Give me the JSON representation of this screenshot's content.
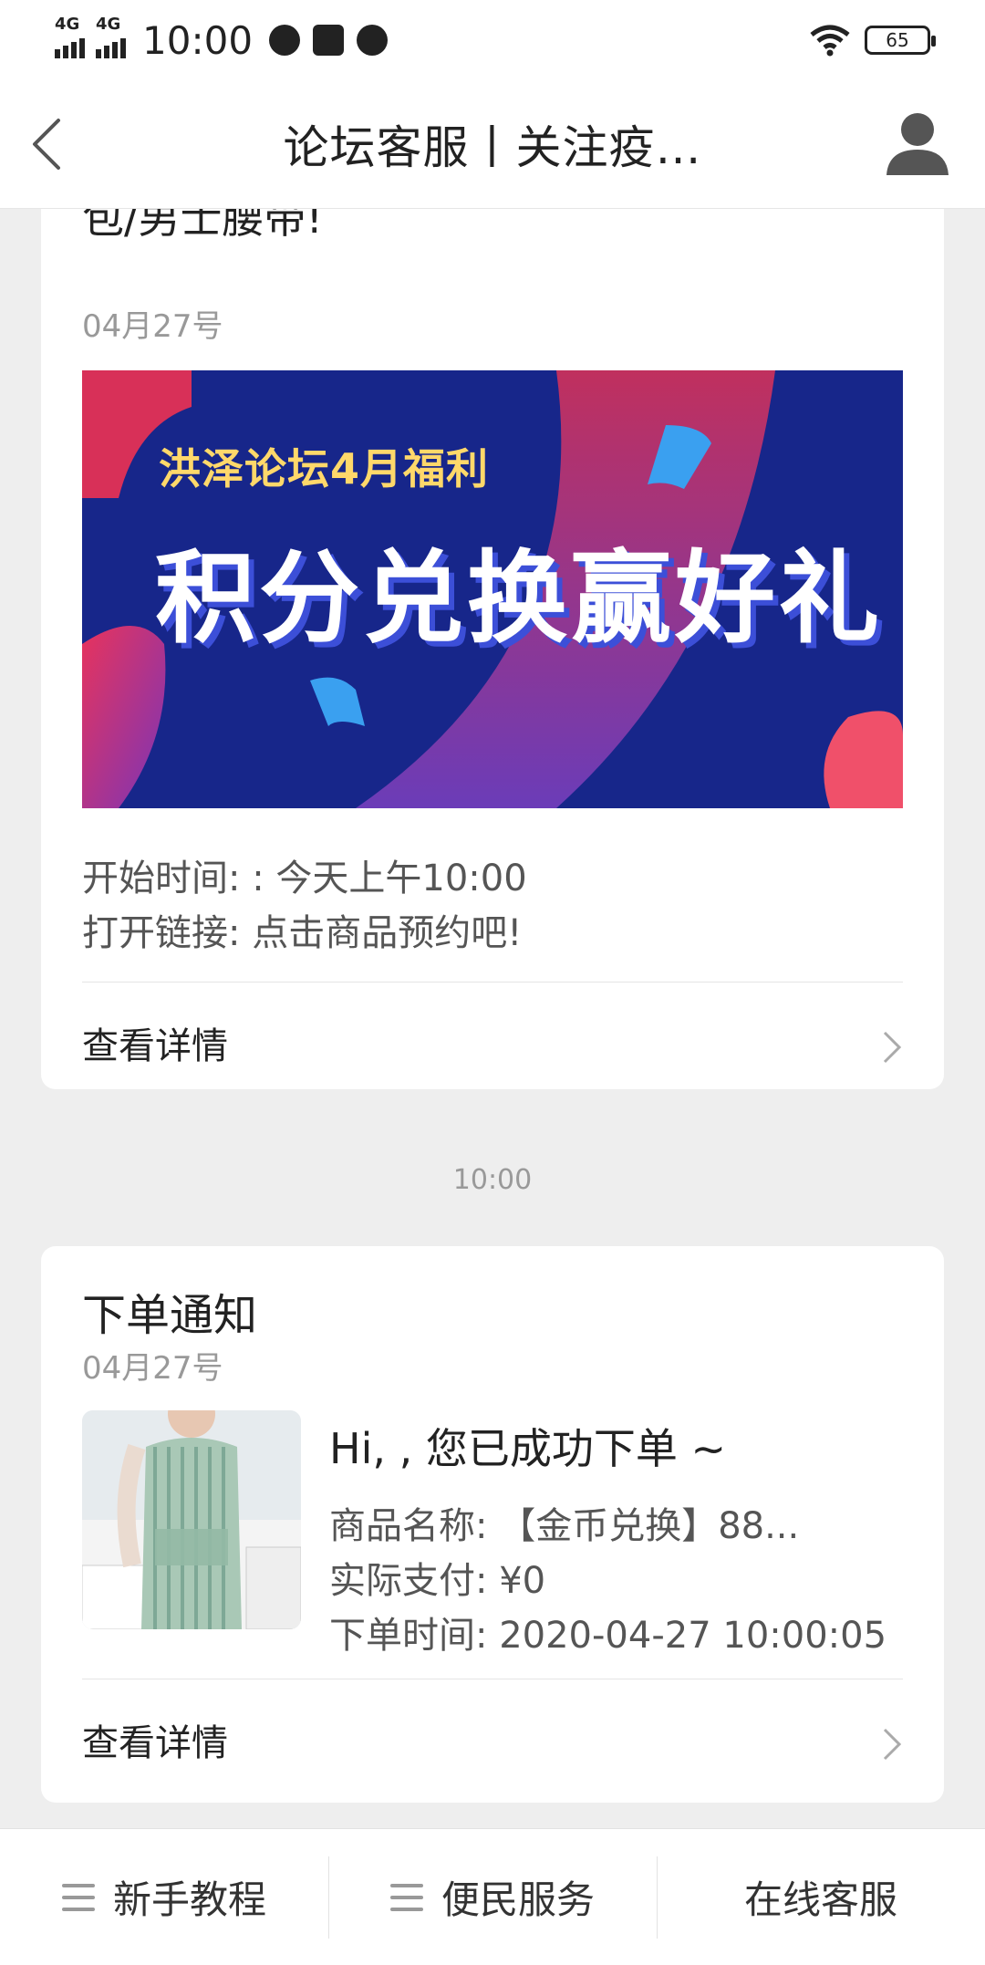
{
  "status": {
    "network1": "4G",
    "network2": "4G",
    "time": "10:00",
    "battery": "65"
  },
  "header": {
    "title": "论坛客服丨关注疫…"
  },
  "card1": {
    "title": "包/男士腰带!",
    "date": "04月27号",
    "banner_subtitle": "洪泽论坛4月福利",
    "banner_title": "积分兑换赢好礼",
    "start_time": "开始时间: : 今天上午10:00",
    "open_link": "打开链接: 点击商品预约吧!",
    "detail_label": "查看详情"
  },
  "timestamp": "10:00",
  "card2": {
    "title": "下单通知",
    "date": "04月27号",
    "greeting": "Hi,  , 您已成功下单 ~",
    "product_name": "商品名称: 【金币兑换】88...",
    "payment": "实际支付: ¥0",
    "order_time": "下单时间: 2020-04-27 10:00:05",
    "detail_label": "查看详情"
  },
  "bottom_nav": {
    "item1": "新手教程",
    "item2": "便民服务",
    "item3": "在线客服"
  },
  "colors": {
    "banner_bg": "#1a2a8a",
    "banner_accent": "#d8305a",
    "banner_highlight": "#ffd86a"
  }
}
